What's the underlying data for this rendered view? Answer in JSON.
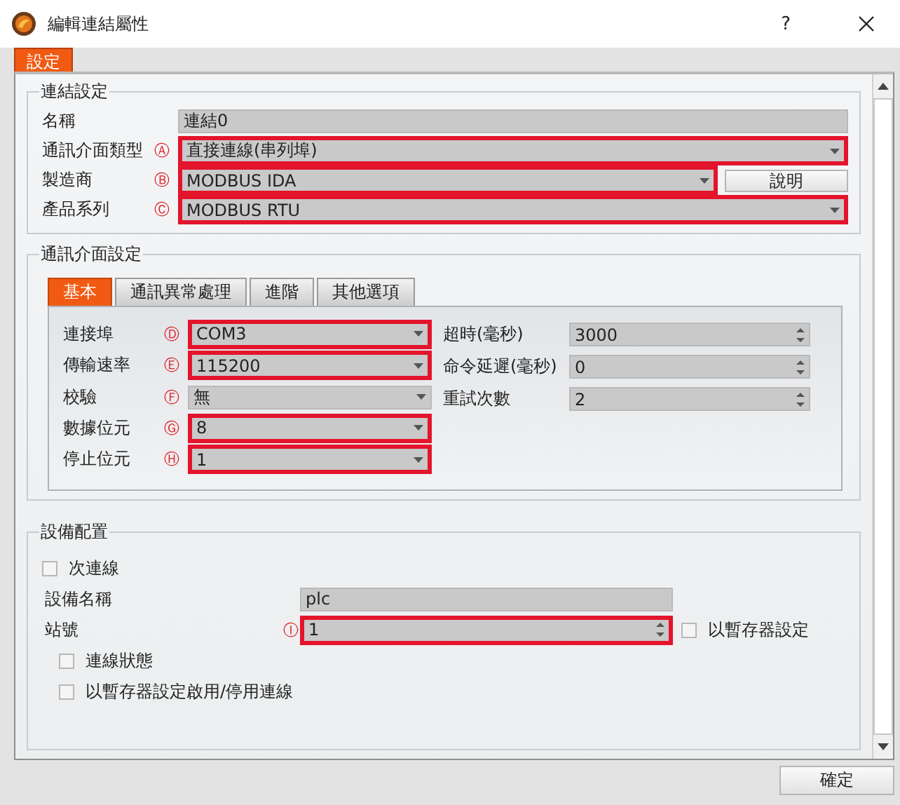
{
  "window": {
    "title": "編輯連結屬性",
    "help": "?"
  },
  "tabs": [
    {
      "label": "設定",
      "selected": true
    }
  ],
  "link_settings": {
    "title": "連結設定",
    "rows": [
      {
        "label": "名稱",
        "kind": "text",
        "value": "連結0",
        "highlighted": false
      },
      {
        "label": "通訊介面類型",
        "marker": "Ⓐ",
        "kind": "dropdown",
        "value": "直接連線(串列埠)",
        "highlighted": true
      },
      {
        "label": "製造商",
        "marker": "Ⓑ",
        "kind": "dropdown",
        "value": "MODBUS IDA",
        "highlighted": true,
        "button": "說明"
      },
      {
        "label": "產品系列",
        "marker": "Ⓒ",
        "kind": "dropdown",
        "value": "MODBUS RTU",
        "highlighted": true
      }
    ]
  },
  "comm_settings": {
    "title": "通訊介面設定",
    "tabs": [
      {
        "label": "基本",
        "selected": true
      },
      {
        "label": "通訊異常處理",
        "selected": false
      },
      {
        "label": "進階",
        "selected": false
      },
      {
        "label": "其他選項",
        "selected": false
      }
    ],
    "left_rows": [
      {
        "label": "連接埠",
        "marker": "Ⓓ",
        "kind": "dropdown",
        "value": "COM3",
        "highlighted": true
      },
      {
        "label": "傳輸速率",
        "marker": "Ⓔ",
        "kind": "dropdown",
        "value": "115200",
        "highlighted": true
      },
      {
        "label": "校驗",
        "marker": "Ⓕ",
        "kind": "dropdown",
        "value": "無",
        "highlighted": false
      },
      {
        "label": "數據位元",
        "marker": "Ⓖ",
        "kind": "dropdown",
        "value": "8",
        "highlighted": true
      },
      {
        "label": "停止位元",
        "marker": "Ⓗ",
        "kind": "dropdown",
        "value": "1",
        "highlighted": true
      }
    ],
    "right_rows": [
      {
        "label": "超時(毫秒)",
        "kind": "spinner",
        "value": "3000",
        "highlighted": false
      },
      {
        "label": "命令延遲(毫秒)",
        "kind": "spinner",
        "value": "0",
        "highlighted": false
      },
      {
        "label": "重試次數",
        "kind": "spinner",
        "value": "2",
        "highlighted": false
      }
    ]
  },
  "device": {
    "title": "設備配置",
    "items": [
      {
        "kind": "checkbox",
        "label": "次連線",
        "checked": false
      },
      {
        "kind": "text",
        "label": "設備名稱",
        "value": "plc",
        "highlighted": false
      },
      {
        "kind": "spinner",
        "label": "站號",
        "marker": "Ⓘ",
        "value": "1",
        "highlighted": true,
        "side_checkbox": {
          "label": "以暫存器設定",
          "checked": false
        }
      },
      {
        "kind": "checkbox",
        "label": "連線狀態",
        "checked": false
      },
      {
        "kind": "checkbox",
        "label": "以暫存器設定啟用/停用連線",
        "checked": false
      }
    ]
  },
  "buttons": [
    {
      "label": "確定"
    }
  ]
}
